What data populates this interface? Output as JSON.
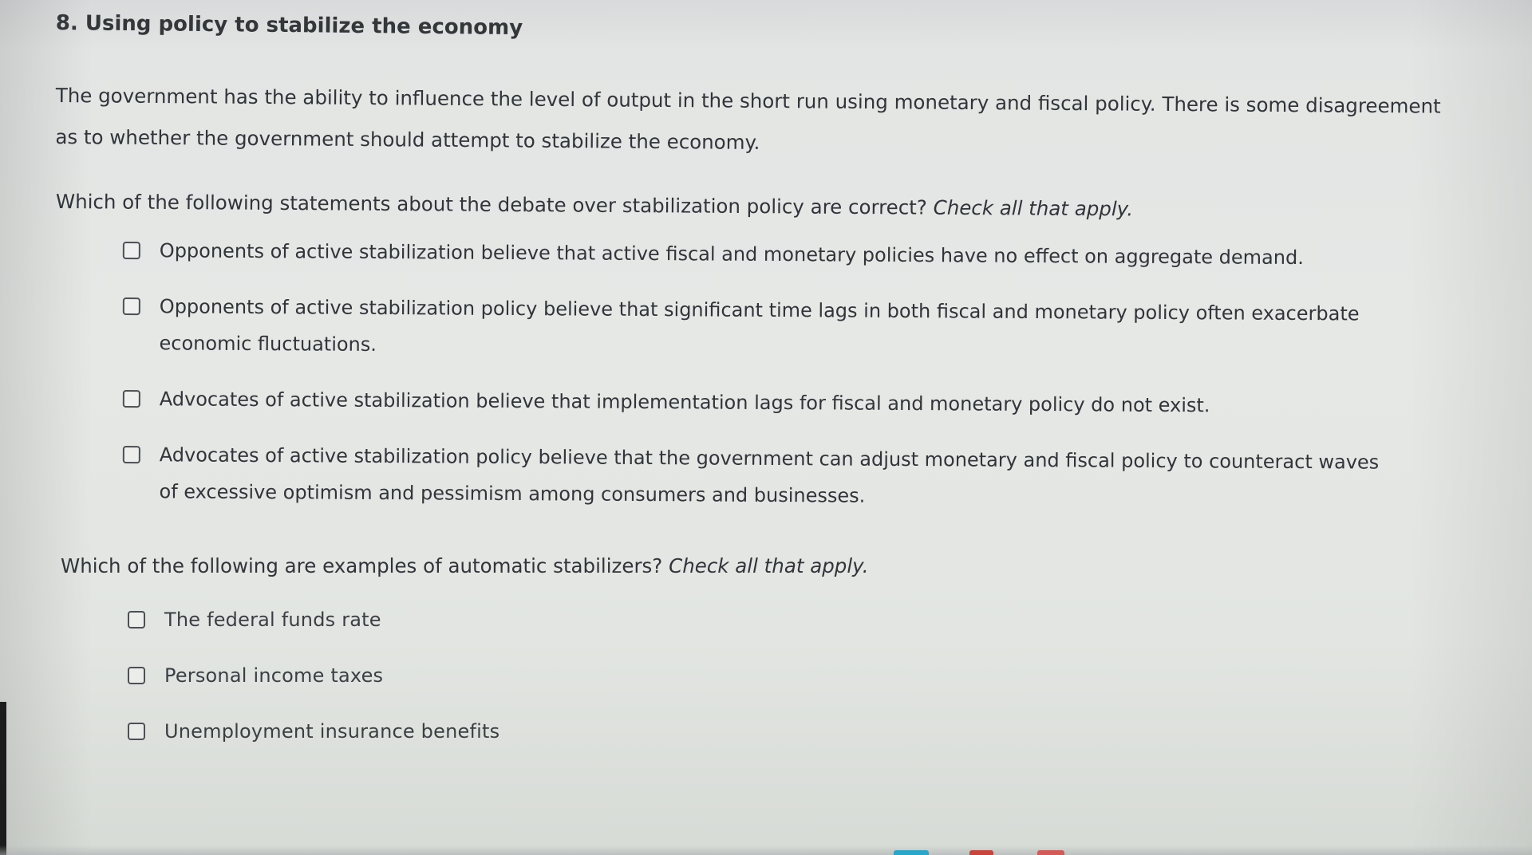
{
  "question": {
    "title": "8. Using policy to stabilize the economy",
    "intro": "The government has the ability to influence the level of output in the short run using monetary and fiscal policy. There is some disagreement as to whether the government should attempt to stabilize the economy.",
    "part1": {
      "prompt": "Which of the following statements about the debate over stabilization policy are correct?",
      "hint": "Check all that apply.",
      "options": [
        {
          "label": "Opponents of active stabilization believe that active fiscal and monetary policies have no effect on aggregate demand."
        },
        {
          "label": "Opponents of active stabilization policy believe that significant time lags in both fiscal and monetary policy often exacerbate economic fluctuations."
        },
        {
          "label": "Advocates of active stabilization believe that implementation lags for fiscal and monetary policy do not exist."
        },
        {
          "label": "Advocates of active stabilization policy believe that the government can adjust monetary and fiscal policy to counteract waves of excessive optimism and pessimism among consumers and businesses."
        }
      ]
    },
    "part2": {
      "prompt": "Which of the following are examples of automatic stabilizers?",
      "hint": "Check all that apply.",
      "options": [
        {
          "label": "The federal funds rate"
        },
        {
          "label": "Personal income taxes"
        },
        {
          "label": "Unemployment insurance benefits"
        }
      ]
    }
  },
  "colors": {
    "text": "#30353a",
    "background": "#e4e6e4",
    "checkbox_border": "#4b5054"
  }
}
